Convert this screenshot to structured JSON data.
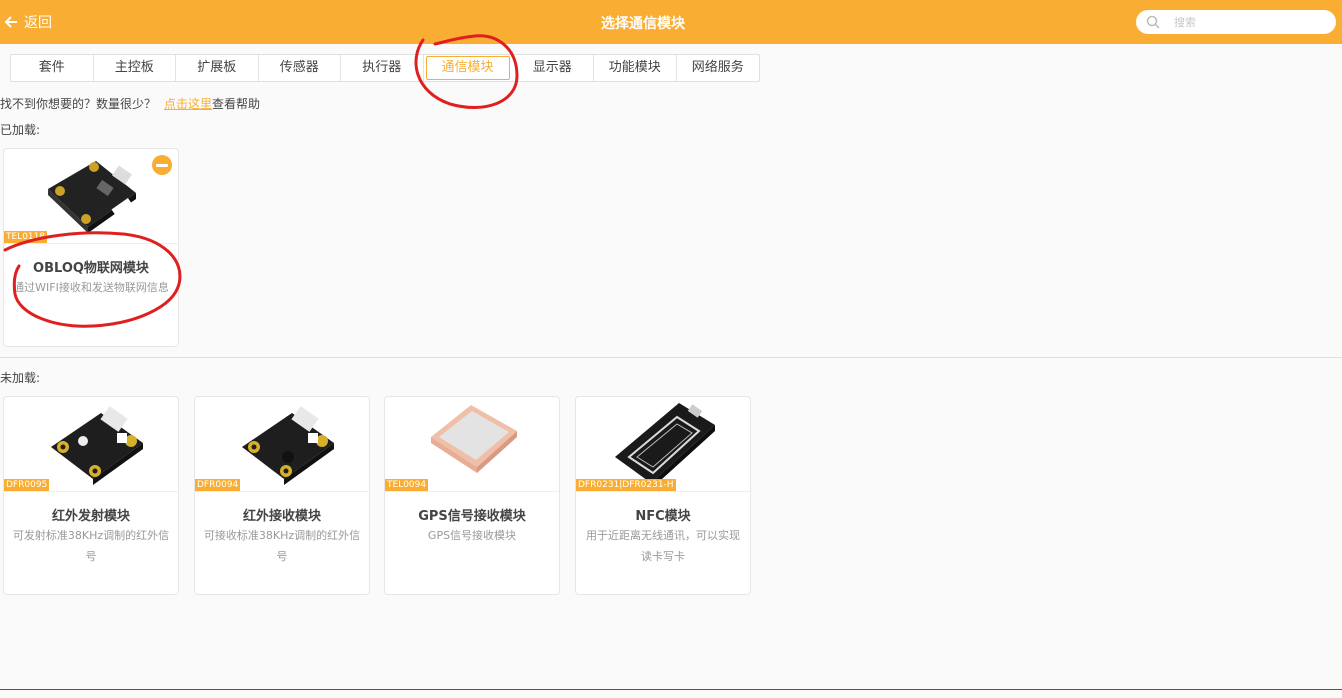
{
  "header": {
    "back_label": "返回",
    "title": "选择通信模块",
    "search_placeholder": "搜索"
  },
  "tabs": [
    {
      "label": "套件"
    },
    {
      "label": "主控板"
    },
    {
      "label": "扩展板"
    },
    {
      "label": "传感器"
    },
    {
      "label": "执行器"
    },
    {
      "label": "通信模块",
      "active": true
    },
    {
      "label": "显示器"
    },
    {
      "label": "功能模块"
    },
    {
      "label": "网络服务"
    }
  ],
  "help": {
    "text_prefix": "找不到你想要的？数量很少？",
    "link_label": "点击这里",
    "text_suffix": "查看帮助"
  },
  "loaded": {
    "label": "已加载:",
    "items": [
      {
        "code": "TEL0118",
        "name": "OBLOQ物联网模块",
        "desc": "通过WIFI接收和发送物联网信息"
      }
    ]
  },
  "unloaded": {
    "label": "未加载:",
    "items": [
      {
        "code": "DFR0095",
        "name": "红外发射模块",
        "desc": "可发射标准38KHz调制的红外信号"
      },
      {
        "code": "DFR0094",
        "name": "红外接收模块",
        "desc": "可接收标准38KHz调制的红外信号"
      },
      {
        "code": "TEL0094",
        "name": "GPS信号接收模块",
        "desc": "GPS信号接收模块"
      },
      {
        "code": "DFR0231|DFR0231-H",
        "name": "NFC模块",
        "desc": "用于近距离无线通讯，可以实现读卡写卡"
      }
    ]
  },
  "colors": {
    "accent": "#f9ae33",
    "annotation": "#e02020"
  },
  "icons": {
    "back": "arrow-left-icon",
    "search": "search-icon",
    "remove": "minus-circle-icon"
  }
}
